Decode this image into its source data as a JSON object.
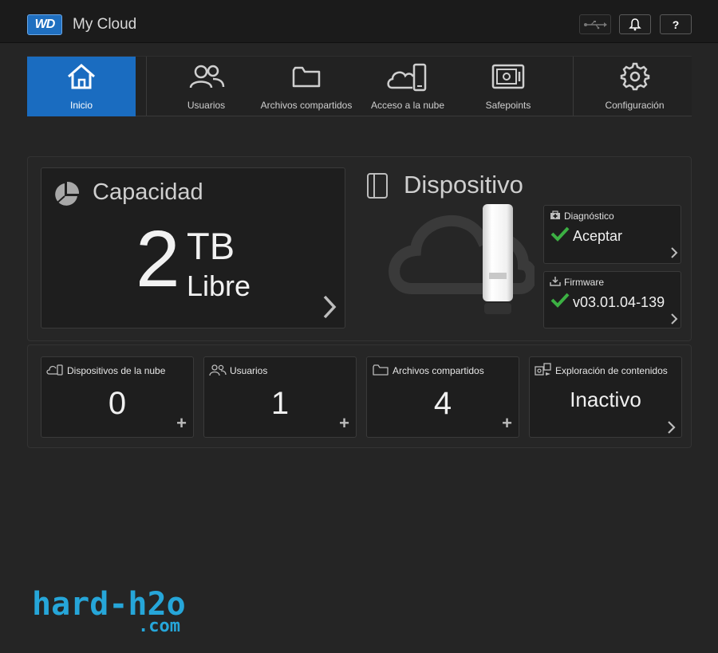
{
  "header": {
    "logo_text": "WD",
    "app_title": "My Cloud",
    "usb_icon": "usb-icon",
    "bell_icon": "bell-icon",
    "help_label": "?"
  },
  "nav": {
    "items": [
      {
        "label": "Inicio",
        "icon": "home-icon",
        "active": true
      },
      {
        "label": "Usuarios",
        "icon": "users-icon"
      },
      {
        "label": "Archivos compartidos",
        "icon": "folder-icon"
      },
      {
        "label": "Acceso a la nube",
        "icon": "cloud-device-icon"
      },
      {
        "label": "Safepoints",
        "icon": "safe-icon"
      },
      {
        "label": "Configuración",
        "icon": "gear-icon"
      }
    ]
  },
  "capacity": {
    "title": "Capacidad",
    "value": "2",
    "unit": "TB",
    "free_label": "Libre"
  },
  "device": {
    "title": "Dispositivo",
    "diagnostics": {
      "title": "Diagnóstico",
      "value": "Aceptar"
    },
    "firmware": {
      "title": "Firmware",
      "value": "v03.01.04-139"
    }
  },
  "stats": [
    {
      "label": "Dispositivos de la nube",
      "value": "0",
      "action": "+"
    },
    {
      "label": "Usuarios",
      "value": "1",
      "action": "+"
    },
    {
      "label": "Archivos compartidos",
      "value": "4",
      "action": "+"
    },
    {
      "label": "Exploración de contenidos",
      "value": "Inactivo",
      "action": "›"
    }
  ],
  "watermark": {
    "line1": "hard-h2o",
    "line2": ".com"
  },
  "colors": {
    "accent": "#1a6cc0",
    "check": "#3cb043",
    "background": "#252525",
    "watermark": "#26a6d9"
  }
}
